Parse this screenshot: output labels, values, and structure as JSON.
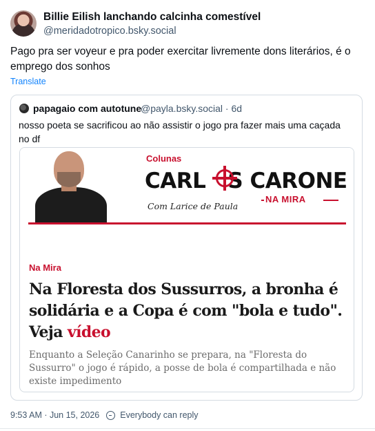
{
  "post": {
    "author_name": "Billie Eilish lanchando calcinha comestível",
    "author_handle": "@meridadotropico.bsky.social",
    "text": "Pago pra ser voyeur e pra poder exercitar livremente dons literários, é o emprego dos sonhos",
    "translate_label": "Translate",
    "timestamp": "9:53 AM · Jun 15, 2026",
    "reply_setting": "Everybody can reply"
  },
  "quote": {
    "author_name": "papagaio com autotune",
    "author_handle_time": "@payla.bsky.social · 6d",
    "text": "nosso poeta se sacrificou ao não assistir o jogo pra fazer mais uma caçada no df",
    "card": {
      "banner": {
        "section": "Colunas",
        "title_left": "CARL",
        "title_right": "S CARONE",
        "subtitle_brand": "NA MIRA",
        "byline": "Com Larice de Paula"
      },
      "label": "Na Mira",
      "headline_main": "Na Floresta dos Sussurros, a bronha é solidária e a Copa é com \"bola e tudo\". Veja ",
      "headline_highlight": "vídeo",
      "description": "Enquanto a Seleção Canarinho se prepara, na \"Floresta do Sussurro\" o jogo é rápido, a posse de bola é compartilhada e não existe impedimento"
    }
  },
  "colors": {
    "link": "#1083fe",
    "brand_red": "#c8102e",
    "muted": "#42576c"
  }
}
